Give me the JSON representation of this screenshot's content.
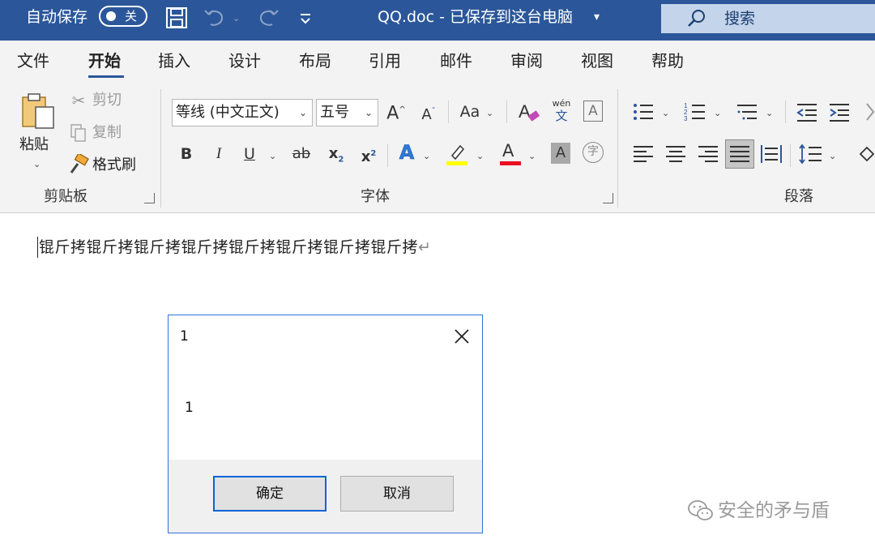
{
  "titlebar": {
    "autosave_label": "自动保存",
    "autosave_state": "关",
    "doc_title": "QQ.doc  -  已保存到这台电脑",
    "search_label": "搜索",
    "icons": [
      "save-icon",
      "undo-icon",
      "redo-icon",
      "customize-qat-icon"
    ]
  },
  "tabs": [
    "文件",
    "开始",
    "插入",
    "设计",
    "布局",
    "引用",
    "邮件",
    "审阅",
    "视图",
    "帮助"
  ],
  "active_tab": "开始",
  "ribbon": {
    "clipboard": {
      "paste": "粘贴",
      "cut": "剪切",
      "copy": "复制",
      "format_painter": "格式刷",
      "group_label": "剪贴板"
    },
    "font": {
      "font_name": "等线 (中文正文)",
      "font_size": "五号",
      "group_label": "字体",
      "bold": "B",
      "italic": "I",
      "underline": "U",
      "strike": "ab",
      "subscript": "x",
      "superscript": "x",
      "grow": "A",
      "shrink": "A",
      "change_case": "Aa",
      "phonetic_top": "wén",
      "phonetic_bottom": "文",
      "text_effects": "A",
      "font_color": "A",
      "char_shading": "A",
      "enclose": "字"
    },
    "paragraph": {
      "group_label": "段落"
    }
  },
  "document": {
    "text": "锟斤拷锟斤拷锟斤拷锟斤拷锟斤拷锟斤拷锟斤拷锟斤拷"
  },
  "dialog": {
    "title": "1",
    "message": "1",
    "ok_label": "确定",
    "cancel_label": "取消"
  },
  "watermark": {
    "text": "安全的矛与盾"
  },
  "colors": {
    "title_bar": "#2b579a",
    "highlight": "#ffff00",
    "font_color": "#e81123",
    "dialog_border": "#2f72d6",
    "ok_border": "#0a64d8"
  }
}
